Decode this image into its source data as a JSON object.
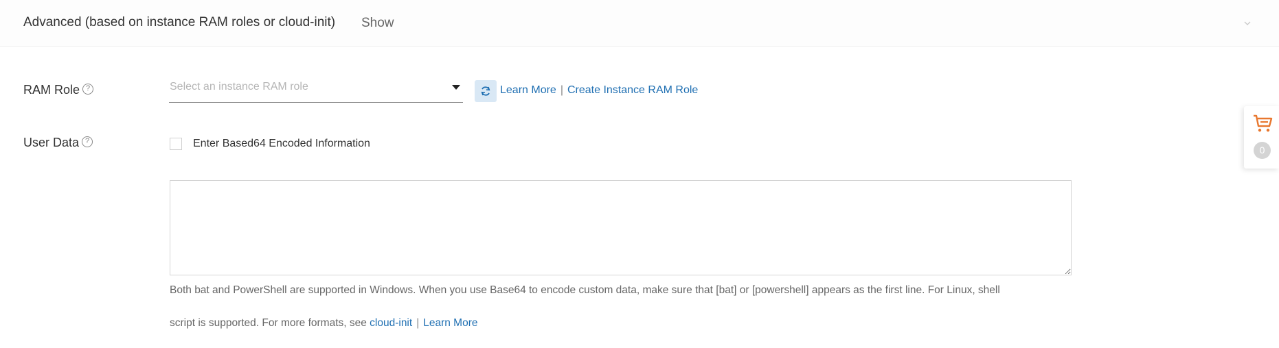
{
  "advanced": {
    "title": "Advanced (based on instance RAM roles or cloud-init)",
    "show_label": "Show"
  },
  "ram_role": {
    "label": "RAM Role",
    "placeholder": "Select an instance RAM role",
    "learn_more": "Learn More",
    "separator": "|",
    "create_link": "Create Instance RAM Role"
  },
  "user_data": {
    "label": "User Data",
    "checkbox_label": "Enter Based64 Encoded Information",
    "checkbox_checked": false,
    "textarea_value": "",
    "help_line1": "Both bat and PowerShell are supported in Windows. When you use Base64 to encode custom data, make sure that [bat] or [powershell] appears as the first line. For Linux, shell",
    "help_line2": "script is supported. For more formats, see ",
    "cloud_init_link": "cloud-init",
    "separator": "|",
    "learn_more_link": "Learn More"
  },
  "cart": {
    "count": "0",
    "icon": "shopping-cart-icon",
    "accent": "#e8772e"
  },
  "colors": {
    "link": "#1f6fb2",
    "refresh_bg": "#d9e8f5"
  }
}
